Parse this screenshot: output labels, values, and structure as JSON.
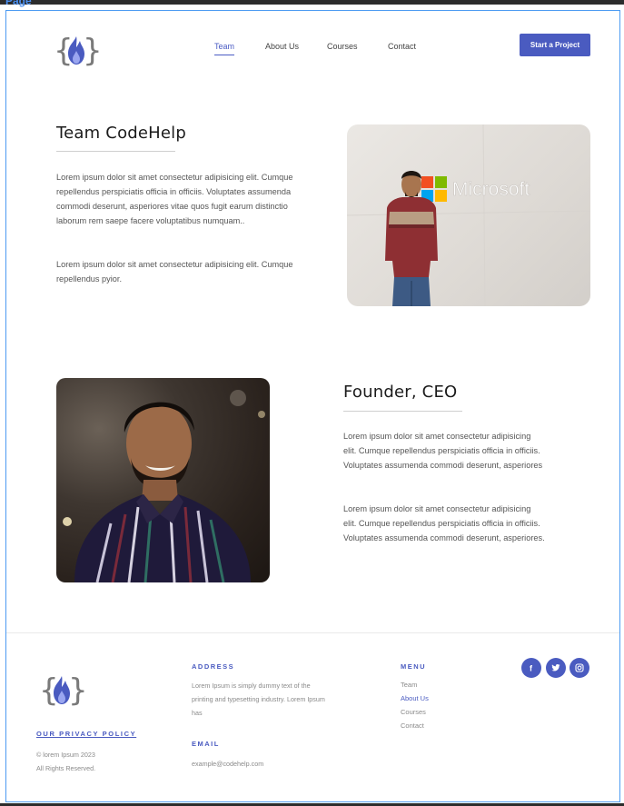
{
  "frame_label": "Page",
  "header": {
    "nav": [
      {
        "label": "Team",
        "active": true
      },
      {
        "label": "About Us",
        "active": false
      },
      {
        "label": "Courses",
        "active": false
      },
      {
        "label": "Contact",
        "active": false
      }
    ],
    "cta_label": "Start a Project"
  },
  "team_section": {
    "title": "Team CodeHelp",
    "paragraph_1": "Lorem ipsum dolor sit amet consectetur adipisicing elit. Cumque repellendus perspiciatis officia in officiis. Voluptates assumenda commodi deserunt, asperiores vitae quos fugit earum distinctio laborum rem saepe facere voluptatibus numquam..",
    "paragraph_2": "Lorem ipsum dolor sit amet consectetur adipisicing elit. Cumque repellendus pyior.",
    "photo_sign_text": "Microsoft"
  },
  "founder_section": {
    "title": "Founder, CEO",
    "paragraph_1": "Lorem ipsum dolor sit amet consectetur adipisicing elit. Cumque repellendus perspiciatis officia in officiis. Voluptates assumenda commodi deserunt, asperiores",
    "paragraph_2": "Lorem ipsum dolor sit amet consectetur adipisicing elit. Cumque repellendus perspiciatis officia in officiis. Voluptates assumenda commodi deserunt, asperiores."
  },
  "footer": {
    "privacy_label": "OUR PRIVACY POLICY",
    "copyright": "© lorem Ipsum 2023",
    "rights": "All Rights Reserved.",
    "address_heading": "ADDRESS",
    "address_text": "Lorem Ipsum is simply dummy text of the printing and typesetting industry. Lorem Ipsum has",
    "email_heading": "EMAIL",
    "email_value": "example@codehelp.com",
    "menu_heading": "MENU",
    "menu_items": [
      {
        "label": "Team",
        "active": false
      },
      {
        "label": "About Us",
        "active": true
      },
      {
        "label": "Courses",
        "active": false
      },
      {
        "label": "Contact",
        "active": false
      }
    ],
    "social_icons": [
      "facebook-icon",
      "twitter-icon",
      "instagram-icon"
    ]
  },
  "colors": {
    "accent": "#4a5bc0",
    "frame_border": "#4d9bf2",
    "heading": "#1b1b1b",
    "body_text": "#555555"
  }
}
